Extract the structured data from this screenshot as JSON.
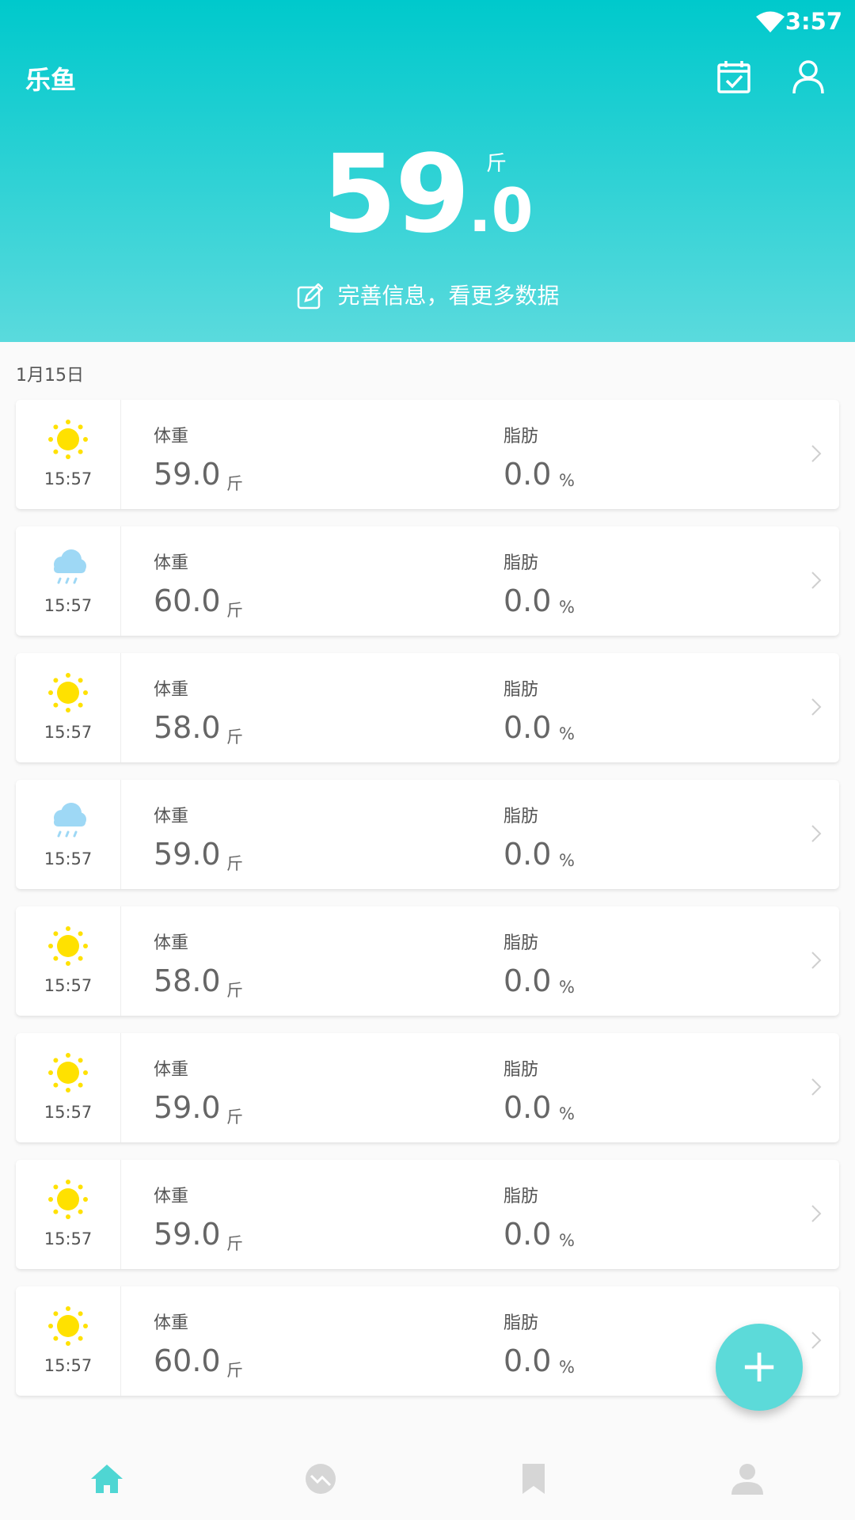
{
  "status_bar": {
    "time": "3:57",
    "wifi_icon": "wifi-icon"
  },
  "header": {
    "app_title": "乐鱼",
    "calendar_icon": "calendar-check-icon",
    "profile_icon": "user-icon",
    "weight_int": "59",
    "weight_dec": ".0",
    "weight_unit": "斤",
    "complete_info_label": "完善信息，看更多数据",
    "complete_info_icon": "edit-icon"
  },
  "colors": {
    "accent": "#00c9cc",
    "accent_light": "#5adadd",
    "fab": "#5cdad9",
    "sun": "#ffe100",
    "cloud": "#9ed8f5"
  },
  "list": {
    "date": "1月15日",
    "records": [
      {
        "weather": "sun",
        "time": "15:57",
        "weight_label": "体重",
        "weight": "59.0",
        "weight_unit": "斤",
        "fat_label": "脂肪",
        "fat": "0.0",
        "fat_unit": "%"
      },
      {
        "weather": "rain",
        "time": "15:57",
        "weight_label": "体重",
        "weight": "60.0",
        "weight_unit": "斤",
        "fat_label": "脂肪",
        "fat": "0.0",
        "fat_unit": "%"
      },
      {
        "weather": "sun",
        "time": "15:57",
        "weight_label": "体重",
        "weight": "58.0",
        "weight_unit": "斤",
        "fat_label": "脂肪",
        "fat": "0.0",
        "fat_unit": "%"
      },
      {
        "weather": "rain",
        "time": "15:57",
        "weight_label": "体重",
        "weight": "59.0",
        "weight_unit": "斤",
        "fat_label": "脂肪",
        "fat": "0.0",
        "fat_unit": "%"
      },
      {
        "weather": "sun",
        "time": "15:57",
        "weight_label": "体重",
        "weight": "58.0",
        "weight_unit": "斤",
        "fat_label": "脂肪",
        "fat": "0.0",
        "fat_unit": "%"
      },
      {
        "weather": "sun",
        "time": "15:57",
        "weight_label": "体重",
        "weight": "59.0",
        "weight_unit": "斤",
        "fat_label": "脂肪",
        "fat": "0.0",
        "fat_unit": "%"
      },
      {
        "weather": "sun",
        "time": "15:57",
        "weight_label": "体重",
        "weight": "59.0",
        "weight_unit": "斤",
        "fat_label": "脂肪",
        "fat": "0.0",
        "fat_unit": "%"
      },
      {
        "weather": "sun",
        "time": "15:57",
        "weight_label": "体重",
        "weight": "60.0",
        "weight_unit": "斤",
        "fat_label": "脂肪",
        "fat": "0.0",
        "fat_unit": "%"
      }
    ]
  },
  "fab": {
    "label": "+"
  },
  "bottom_nav": {
    "items": [
      {
        "icon": "home-icon",
        "active": true
      },
      {
        "icon": "trend-icon",
        "active": false
      },
      {
        "icon": "bookmark-icon",
        "active": false
      },
      {
        "icon": "person-icon",
        "active": false
      }
    ]
  }
}
